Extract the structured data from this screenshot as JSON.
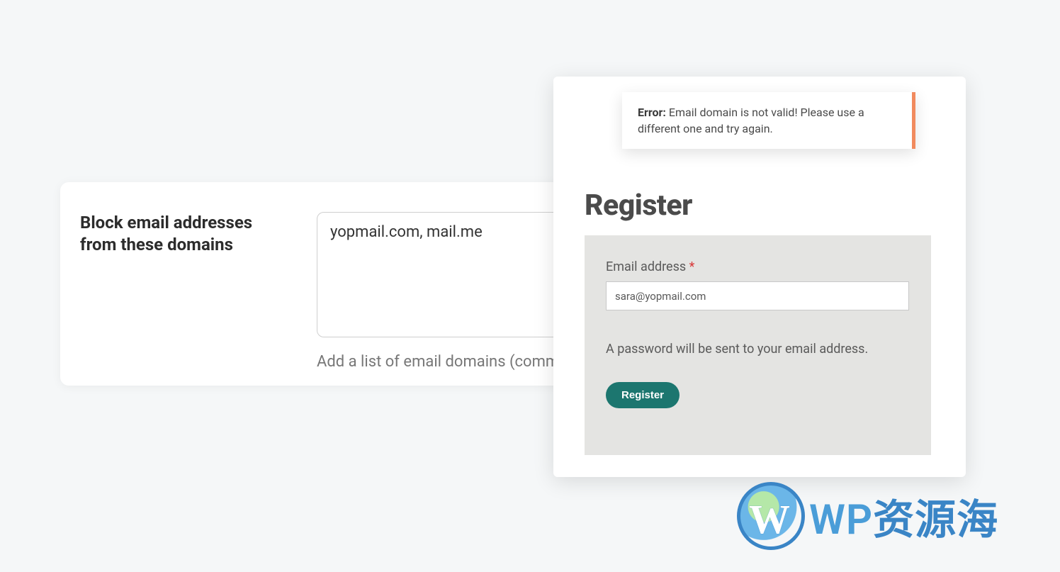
{
  "settings": {
    "label": "Block email addresses from these domains",
    "domains_value": "yopmail.com, mail.me",
    "helper": "Add a list of email domains (comm"
  },
  "register": {
    "error_prefix": "Error:",
    "error_message": " Email domain is not valid! Please use a different one and try again.",
    "heading": "Register",
    "email_label": "Email address ",
    "required_mark": "*",
    "email_value": "sara@yopmail.com",
    "note": "A password will be sent to your email address.",
    "button_label": "Register"
  },
  "watermark": {
    "wp": "WP",
    "rest": "资源海"
  }
}
